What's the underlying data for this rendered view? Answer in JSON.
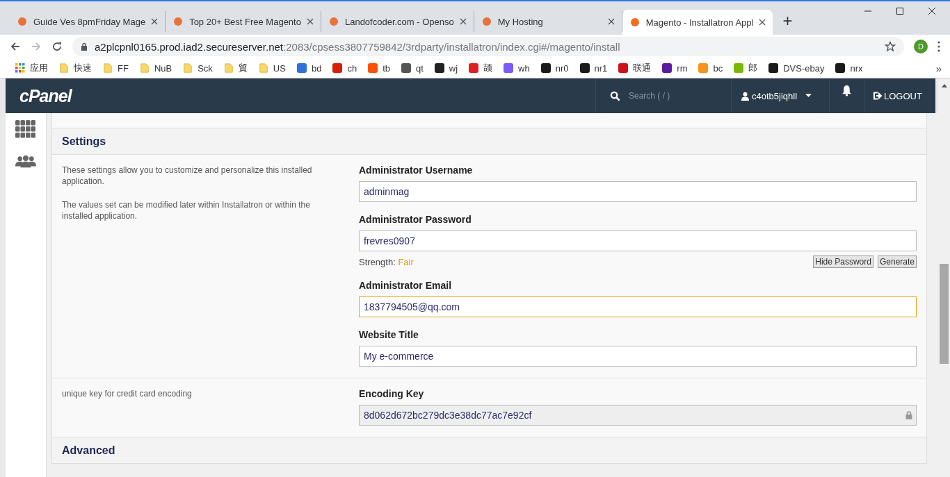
{
  "browser": {
    "tabs": [
      {
        "title": "Guide Ves 8pmFriday Mage",
        "selected": false
      },
      {
        "title": "Top 20+ Best Free Magento",
        "selected": false
      },
      {
        "title": "Landofcoder.com - Openso",
        "selected": false
      },
      {
        "title": "My Hosting",
        "selected": false
      },
      {
        "title": "Magento - Installatron Appl",
        "selected": true
      }
    ],
    "new_tab": "+",
    "address": {
      "host": "a2plcpnl0165.prod.iad2.secureserver.net",
      "path": ":2083/cpsess3807759842/3rdparty/installatron/index.cgi#/magento/install"
    },
    "profile_initial": "D",
    "bookmarks": [
      {
        "label": "应用",
        "kind": "apps"
      },
      {
        "label": "快速",
        "kind": "folder"
      },
      {
        "label": "FF",
        "kind": "folder"
      },
      {
        "label": "NuB",
        "kind": "folder"
      },
      {
        "label": "Sck",
        "kind": "folder"
      },
      {
        "label": "貿",
        "kind": "folder"
      },
      {
        "label": "US",
        "kind": "folder"
      },
      {
        "label": "bd",
        "kind": "site",
        "color": "#2f6fe0"
      },
      {
        "label": "ch",
        "kind": "site",
        "color": "#d81e06"
      },
      {
        "label": "tb",
        "kind": "site",
        "color": "#ff5000"
      },
      {
        "label": "qt",
        "kind": "site",
        "color": "#555555"
      },
      {
        "label": "wj",
        "kind": "site",
        "color": "#222222"
      },
      {
        "label": "颉",
        "kind": "site",
        "color": "#e02020"
      },
      {
        "label": "wh",
        "kind": "site",
        "color": "#7a5af8"
      },
      {
        "label": "nr0",
        "kind": "site",
        "color": "#1a1a1a"
      },
      {
        "label": "nr1",
        "kind": "site",
        "color": "#1a1a1a"
      },
      {
        "label": "联通",
        "kind": "site",
        "color": "#d0101b"
      },
      {
        "label": "rm",
        "kind": "site",
        "color": "#5a1aa0"
      },
      {
        "label": "bc",
        "kind": "site",
        "color": "#f7931a"
      },
      {
        "label": "郎",
        "kind": "site",
        "color": "#7ab800"
      },
      {
        "label": "DVS-ebay",
        "kind": "site",
        "color": "#1a1a1a"
      },
      {
        "label": "nrx",
        "kind": "site",
        "color": "#1a1a1a"
      }
    ],
    "bookmarks_more": "»"
  },
  "header": {
    "logo": "cPanel",
    "search": {
      "placeholder": "Search ( / )"
    },
    "user": "c4otb5jiqhll",
    "logout": "LOGOUT"
  },
  "sections": [
    {
      "title": "Settings",
      "rows": [
        {
          "description": [
            "These settings allow you to customize and personalize this installed application.",
            "The values set can be modified later within Installatron or within the installed application."
          ],
          "fields": [
            {
              "label": "Administrator Username",
              "value": "adminmag",
              "focused": false,
              "locked": false
            },
            {
              "label": "Administrator Password",
              "value": "frevres0907",
              "focused": false,
              "locked": false,
              "strength_label": "Strength:",
              "strength": "Fair",
              "buttons": [
                "Hide Password",
                "Generate"
              ]
            },
            {
              "label": "Administrator Email",
              "value": "1837794505@qq.com",
              "focused": true,
              "locked": false
            },
            {
              "label": "Website Title",
              "value": "My e-commerce",
              "focused": false,
              "locked": false
            }
          ]
        },
        {
          "description": [
            "unique key for credit card encoding"
          ],
          "fields": [
            {
              "label": "Encoding Key",
              "value": "8d062d672bc279dc3e38dc77ac7e92cf",
              "focused": false,
              "locked": true
            }
          ]
        }
      ]
    },
    {
      "title": "Advanced"
    }
  ]
}
